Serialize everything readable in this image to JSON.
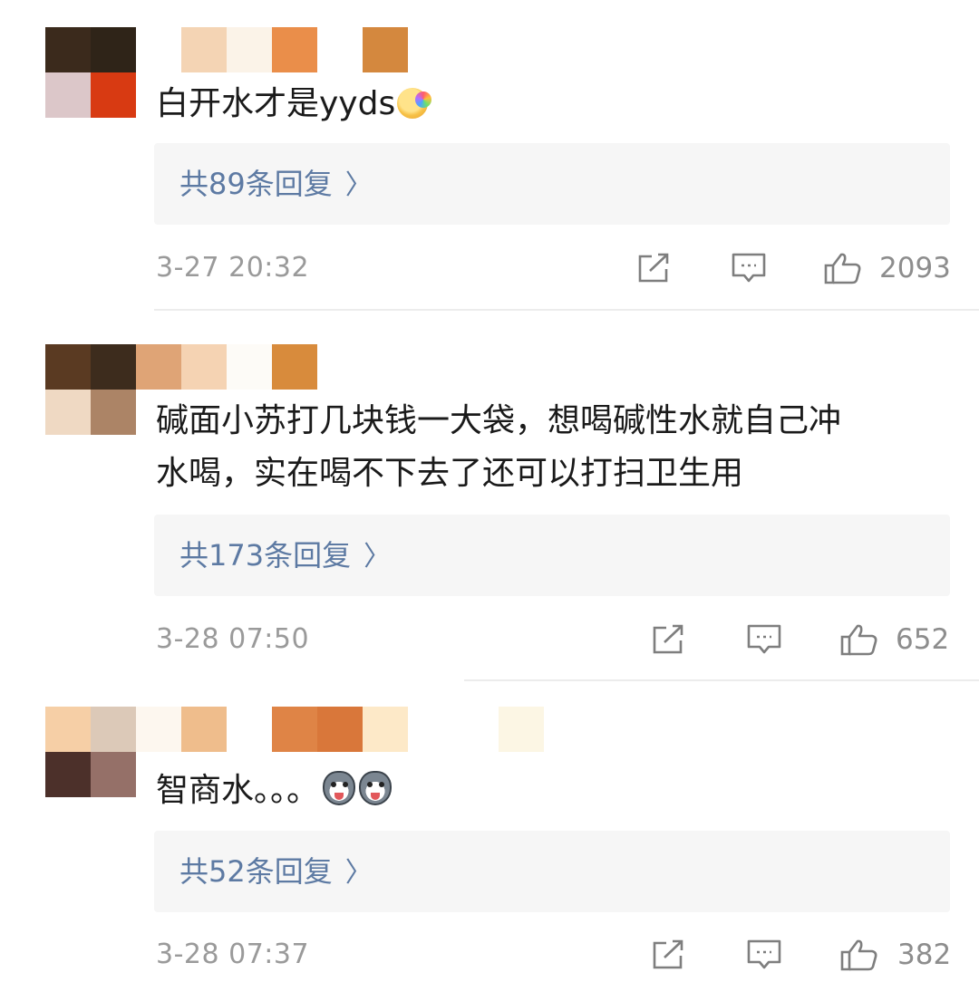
{
  "comments": [
    {
      "text": "白开水才是yyds",
      "emoji": "kissing-rainbow-emoji",
      "reply_label": "共89条回复",
      "time": "3-27 20:32",
      "likes": "2093"
    },
    {
      "text_line1": "碱面小苏打几块钱一大袋，想喝碱性水就自己冲",
      "text_line2": "水喝，实在喝不下去了还可以打扫卫生用",
      "reply_label": "共173条回复",
      "time": "3-28 07:50",
      "likes": "652"
    },
    {
      "text": "智商水。。。",
      "emoji": "husky-emoji",
      "reply_label": "共52条回复",
      "time": "3-28 07:37",
      "likes": "382"
    }
  ],
  "icons": {
    "share": "share-icon",
    "comment": "comment-icon",
    "like": "thumbs-up-icon",
    "reply_chevron": "chevron-right-icon"
  },
  "colors": {
    "link": "#5d7aa3",
    "meta": "#9a9a9a",
    "reply_bg": "#f6f6f6"
  }
}
